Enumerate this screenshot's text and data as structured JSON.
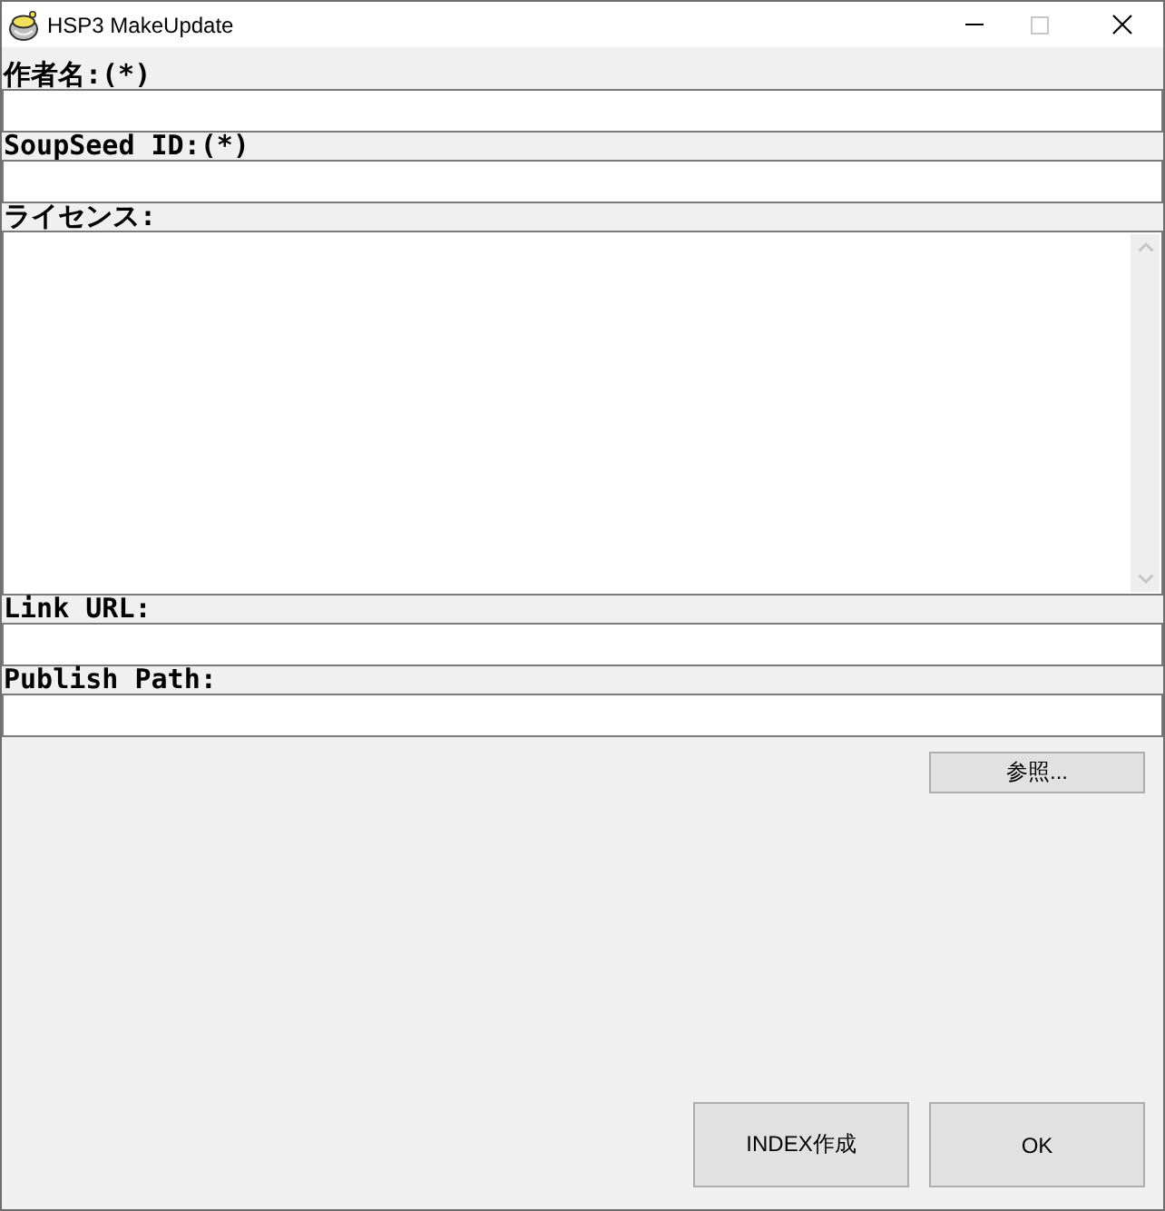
{
  "window": {
    "title": "HSP3 MakeUpdate",
    "controls": [
      {
        "kind": "minimize",
        "disabled": false
      },
      {
        "kind": "maximize",
        "disabled": true
      },
      {
        "kind": "close",
        "disabled": false
      }
    ]
  },
  "fields": [
    {
      "label": "作者名:(*)",
      "kind": "line"
    },
    {
      "label": "SoupSeed ID:(*)",
      "kind": "line"
    },
    {
      "label": "ライセンス:",
      "kind": "multiline"
    },
    {
      "label": "Link URL:",
      "kind": "line"
    },
    {
      "label": "Publish Path:",
      "kind": "line"
    }
  ],
  "browse_button": "参照...",
  "buttons": [
    "INDEX作成",
    "OK"
  ]
}
